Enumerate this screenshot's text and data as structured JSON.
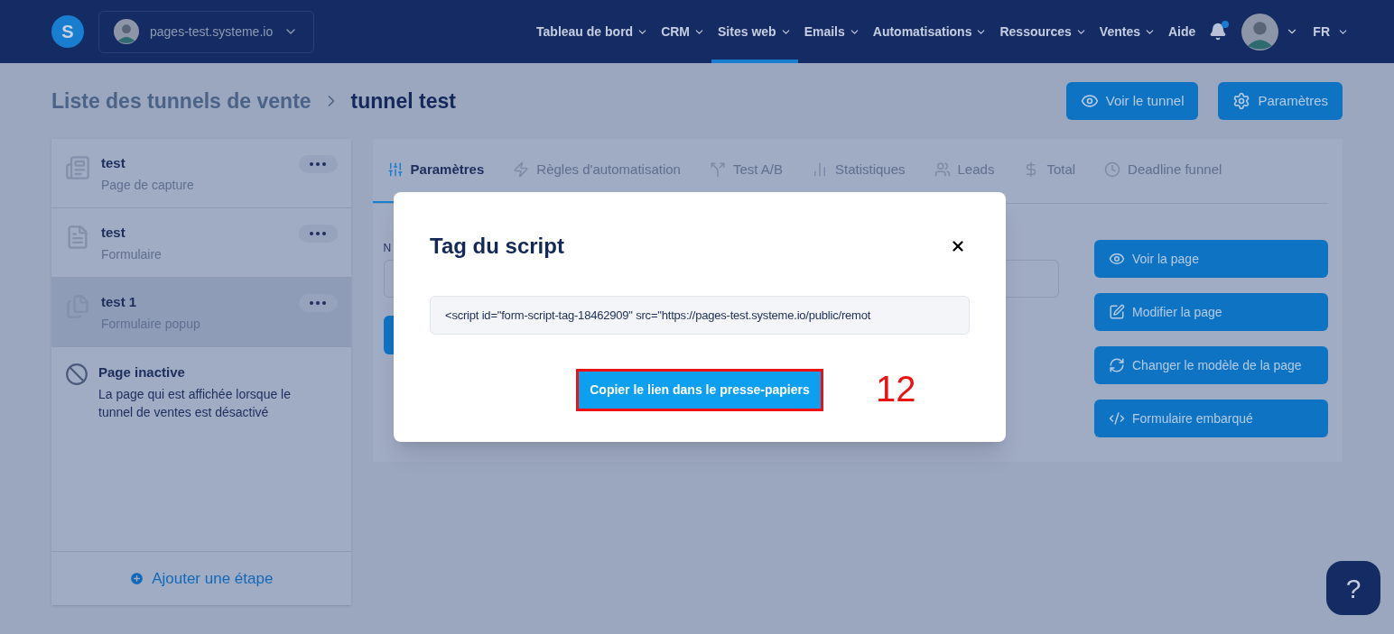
{
  "nav": {
    "logo": "S",
    "site": "pages-test.systeme.io",
    "menu": [
      {
        "label": "Tableau de bord",
        "selected": false,
        "dropdown": true
      },
      {
        "label": "CRM",
        "selected": false,
        "dropdown": true
      },
      {
        "label": "Sites web",
        "selected": true,
        "dropdown": true
      },
      {
        "label": "Emails",
        "selected": false,
        "dropdown": true
      },
      {
        "label": "Automatisations",
        "selected": false,
        "dropdown": true
      },
      {
        "label": "Ressources",
        "selected": false,
        "dropdown": true
      },
      {
        "label": "Ventes",
        "selected": false,
        "dropdown": true
      },
      {
        "label": "Aide",
        "selected": false,
        "dropdown": false
      }
    ],
    "notification_dot": true,
    "language": "FR"
  },
  "breadcrumb": {
    "parent": "Liste des tunnels de vente",
    "current": "tunnel test"
  },
  "header_buttons": [
    {
      "label": "Voir le tunnel",
      "kind": "eye"
    },
    {
      "label": "Paramètres",
      "kind": "gear"
    }
  ],
  "steps": [
    {
      "title": "test",
      "subtitle": "Page de capture",
      "kind": "capture",
      "selected": false
    },
    {
      "title": "test",
      "subtitle": "Formulaire",
      "kind": "form",
      "selected": false
    },
    {
      "title": "test 1",
      "subtitle": "Formulaire popup",
      "kind": "popup",
      "selected": true
    }
  ],
  "inactive_page": {
    "title": "Page inactive",
    "description": "La page qui est affichée lorsque le tunnel de ventes est désactivé"
  },
  "add_step": "Ajouter une étape",
  "tabs": [
    {
      "label": "Paramètres",
      "kind": "sliders",
      "selected": true
    },
    {
      "label": "Règles d'automatisation",
      "kind": "bolt",
      "selected": false
    },
    {
      "label": "Test A/B",
      "kind": "split",
      "selected": false
    },
    {
      "label": "Statistiques",
      "kind": "chart",
      "selected": false
    },
    {
      "label": "Leads",
      "kind": "users",
      "selected": false
    },
    {
      "label": "Total",
      "kind": "dollar",
      "selected": false
    },
    {
      "label": "Deadline funnel",
      "kind": "clock",
      "selected": false
    }
  ],
  "hidden_field_label": "N",
  "page_actions": [
    {
      "label": "Voir la page",
      "kind": "eye"
    },
    {
      "label": "Modifier la page",
      "kind": "edit"
    },
    {
      "label": "Changer le modèle de la page",
      "kind": "refresh"
    },
    {
      "label": "Formulaire embarqué",
      "kind": "code"
    }
  ],
  "modal": {
    "title": "Tag du script",
    "script": "<script id=\"form-script-tag-18462909\" src=\"https://pages-test.systeme.io/public/remot",
    "button": "Copier le lien dans le presse-papiers",
    "annotation": "12"
  },
  "help": "?"
}
